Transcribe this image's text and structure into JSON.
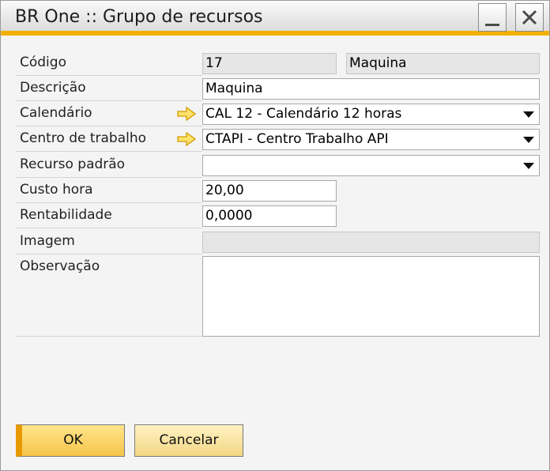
{
  "window": {
    "title": "BR One :: Grupo de recursos",
    "accent_color": "#f2b100"
  },
  "form": {
    "codigo": {
      "label": "Código",
      "value": "17",
      "name_value": "Maquina"
    },
    "descricao": {
      "label": "Descrição",
      "value": "Maquina"
    },
    "calendario": {
      "label": "Calendário",
      "value": "CAL 12 - Calendário 12 horas"
    },
    "centro": {
      "label": "Centro de trabalho",
      "value": "CTAPI - Centro Trabalho API"
    },
    "recurso": {
      "label": "Recurso padrão",
      "value": ""
    },
    "custo": {
      "label": "Custo hora",
      "value": "20,00"
    },
    "rentabilidade": {
      "label": "Rentabilidade",
      "value": "0,0000"
    },
    "imagem": {
      "label": "Imagem",
      "value": ""
    },
    "observacao": {
      "label": "Observação",
      "value": ""
    }
  },
  "buttons": {
    "ok": "OK",
    "cancel": "Cancelar"
  }
}
